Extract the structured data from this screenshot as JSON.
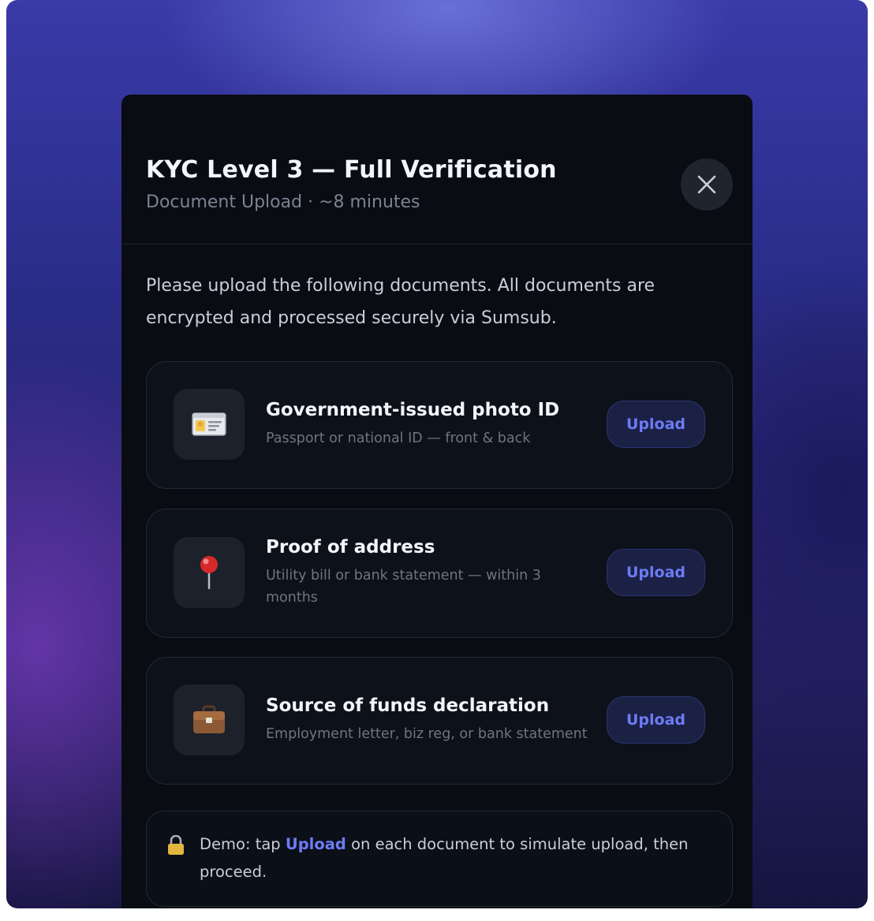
{
  "modal": {
    "title": "KYC Level 3 — Full Verification",
    "subtitle": "Document Upload · ~8 minutes",
    "intro": "Please upload the following documents. All documents are encrypted and processed securely via Sumsub."
  },
  "documents": [
    {
      "icon": "id-card-icon",
      "name": "Government-issued photo ID",
      "description": "Passport or national ID — front & back",
      "button": "Upload"
    },
    {
      "icon": "pushpin-icon",
      "name": "Proof of address",
      "description": "Utility bill or bank statement — within 3 months",
      "button": "Upload"
    },
    {
      "icon": "briefcase-icon",
      "name": "Source of funds declaration",
      "description": "Employment letter, biz reg, or bank statement",
      "button": "Upload"
    }
  ],
  "demo": {
    "icon": "lock-icon",
    "prefix": "Demo: tap ",
    "link": "Upload",
    "suffix": " on each document to simulate upload, then proceed."
  },
  "colors": {
    "accent": "#6c7cf4",
    "modal_bg": "#090c13",
    "card_bg": "#0d1119"
  }
}
